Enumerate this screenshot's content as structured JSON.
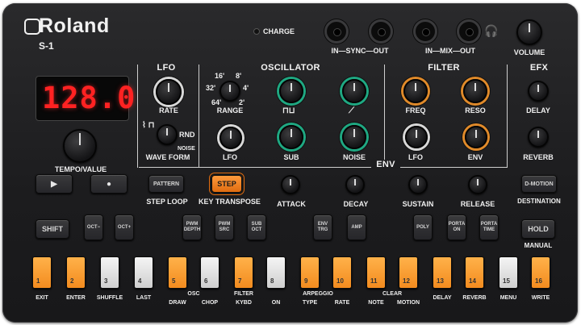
{
  "brand": "Roland",
  "model": "S-1",
  "charge_label": "CHARGE",
  "jacks": {
    "sync_label": "IN—SYNC—OUT",
    "mix_label": "IN—MIX—OUT"
  },
  "volume_label": "VOLUME",
  "display": {
    "value": "128.0",
    "color": "#ff2222"
  },
  "tempo_label": "TEMPO/VALUE",
  "sections": {
    "lfo": "LFO",
    "oscillator": "OSCILLATOR",
    "filter": "FILTER",
    "efx": "EFX",
    "env": "ENV"
  },
  "lfo": {
    "rate": "RATE",
    "wave_form": "WAVE FORM",
    "rnd": "RND",
    "noise": "NOISE"
  },
  "osc": {
    "range": "RANGE",
    "lfo": "LFO",
    "sub": "SUB",
    "noise": "NOISE",
    "range_values": [
      "16'",
      "8'",
      "32'",
      "4'",
      "64'",
      "2'"
    ]
  },
  "filter": {
    "freq": "FREQ",
    "reso": "RESO",
    "lfo": "LFO",
    "env": "ENV"
  },
  "efx": {
    "delay": "DELAY",
    "reverb": "REVERB"
  },
  "env": {
    "attack": "ATTACK",
    "decay": "DECAY",
    "sustain": "SUSTAIN",
    "release": "RELEASE"
  },
  "buttons": {
    "pattern": "PATTERN",
    "step": "STEP",
    "step_loop": "STEP LOOP",
    "key_transpose": "KEY TRANSPOSE",
    "d_motion": "D-MOTION",
    "destination": "DESTINATION",
    "shift": "SHIFT",
    "hold": "HOLD",
    "manual": "MANUAL",
    "oct_minus": "OCT−",
    "oct_plus": "OCT+",
    "pwm_depth": "PWM DEPTH",
    "pwm_src": "PWM SRC",
    "sub_oct": "SUB OCT",
    "env_trg": "ENV TRG",
    "amp": "AMP",
    "poly": "POLY",
    "porta_on": "PORTA ON",
    "porta_time": "PORTA TIME"
  },
  "steps": [
    {
      "n": "1",
      "label": "EXIT"
    },
    {
      "n": "2",
      "label": "ENTER"
    },
    {
      "n": "3",
      "label": "SHUFFLE"
    },
    {
      "n": "4",
      "label": "LAST"
    },
    {
      "n": "5",
      "label": "DRAW"
    },
    {
      "n": "6",
      "label": "CHOP"
    },
    {
      "n": "7",
      "label": "KYBD"
    },
    {
      "n": "8",
      "label": "ON"
    },
    {
      "n": "9",
      "label": "TYPE"
    },
    {
      "n": "10",
      "label": "RATE"
    },
    {
      "n": "11",
      "label": "NOTE"
    },
    {
      "n": "12",
      "label": "MOTION"
    },
    {
      "n": "13",
      "label": "DELAY"
    },
    {
      "n": "14",
      "label": "REVERB"
    },
    {
      "n": "15",
      "label": "MENU"
    },
    {
      "n": "16",
      "label": "WRITE"
    }
  ],
  "step_groups": {
    "osc": "OSC",
    "filter": "FILTER",
    "arpeggio": "ARPEGGIO",
    "clear": "CLEAR"
  },
  "colors": {
    "orange": "#f38c1f",
    "green": "#1fa882",
    "white": "#d8d8d8",
    "red_display": "#ff2222"
  }
}
